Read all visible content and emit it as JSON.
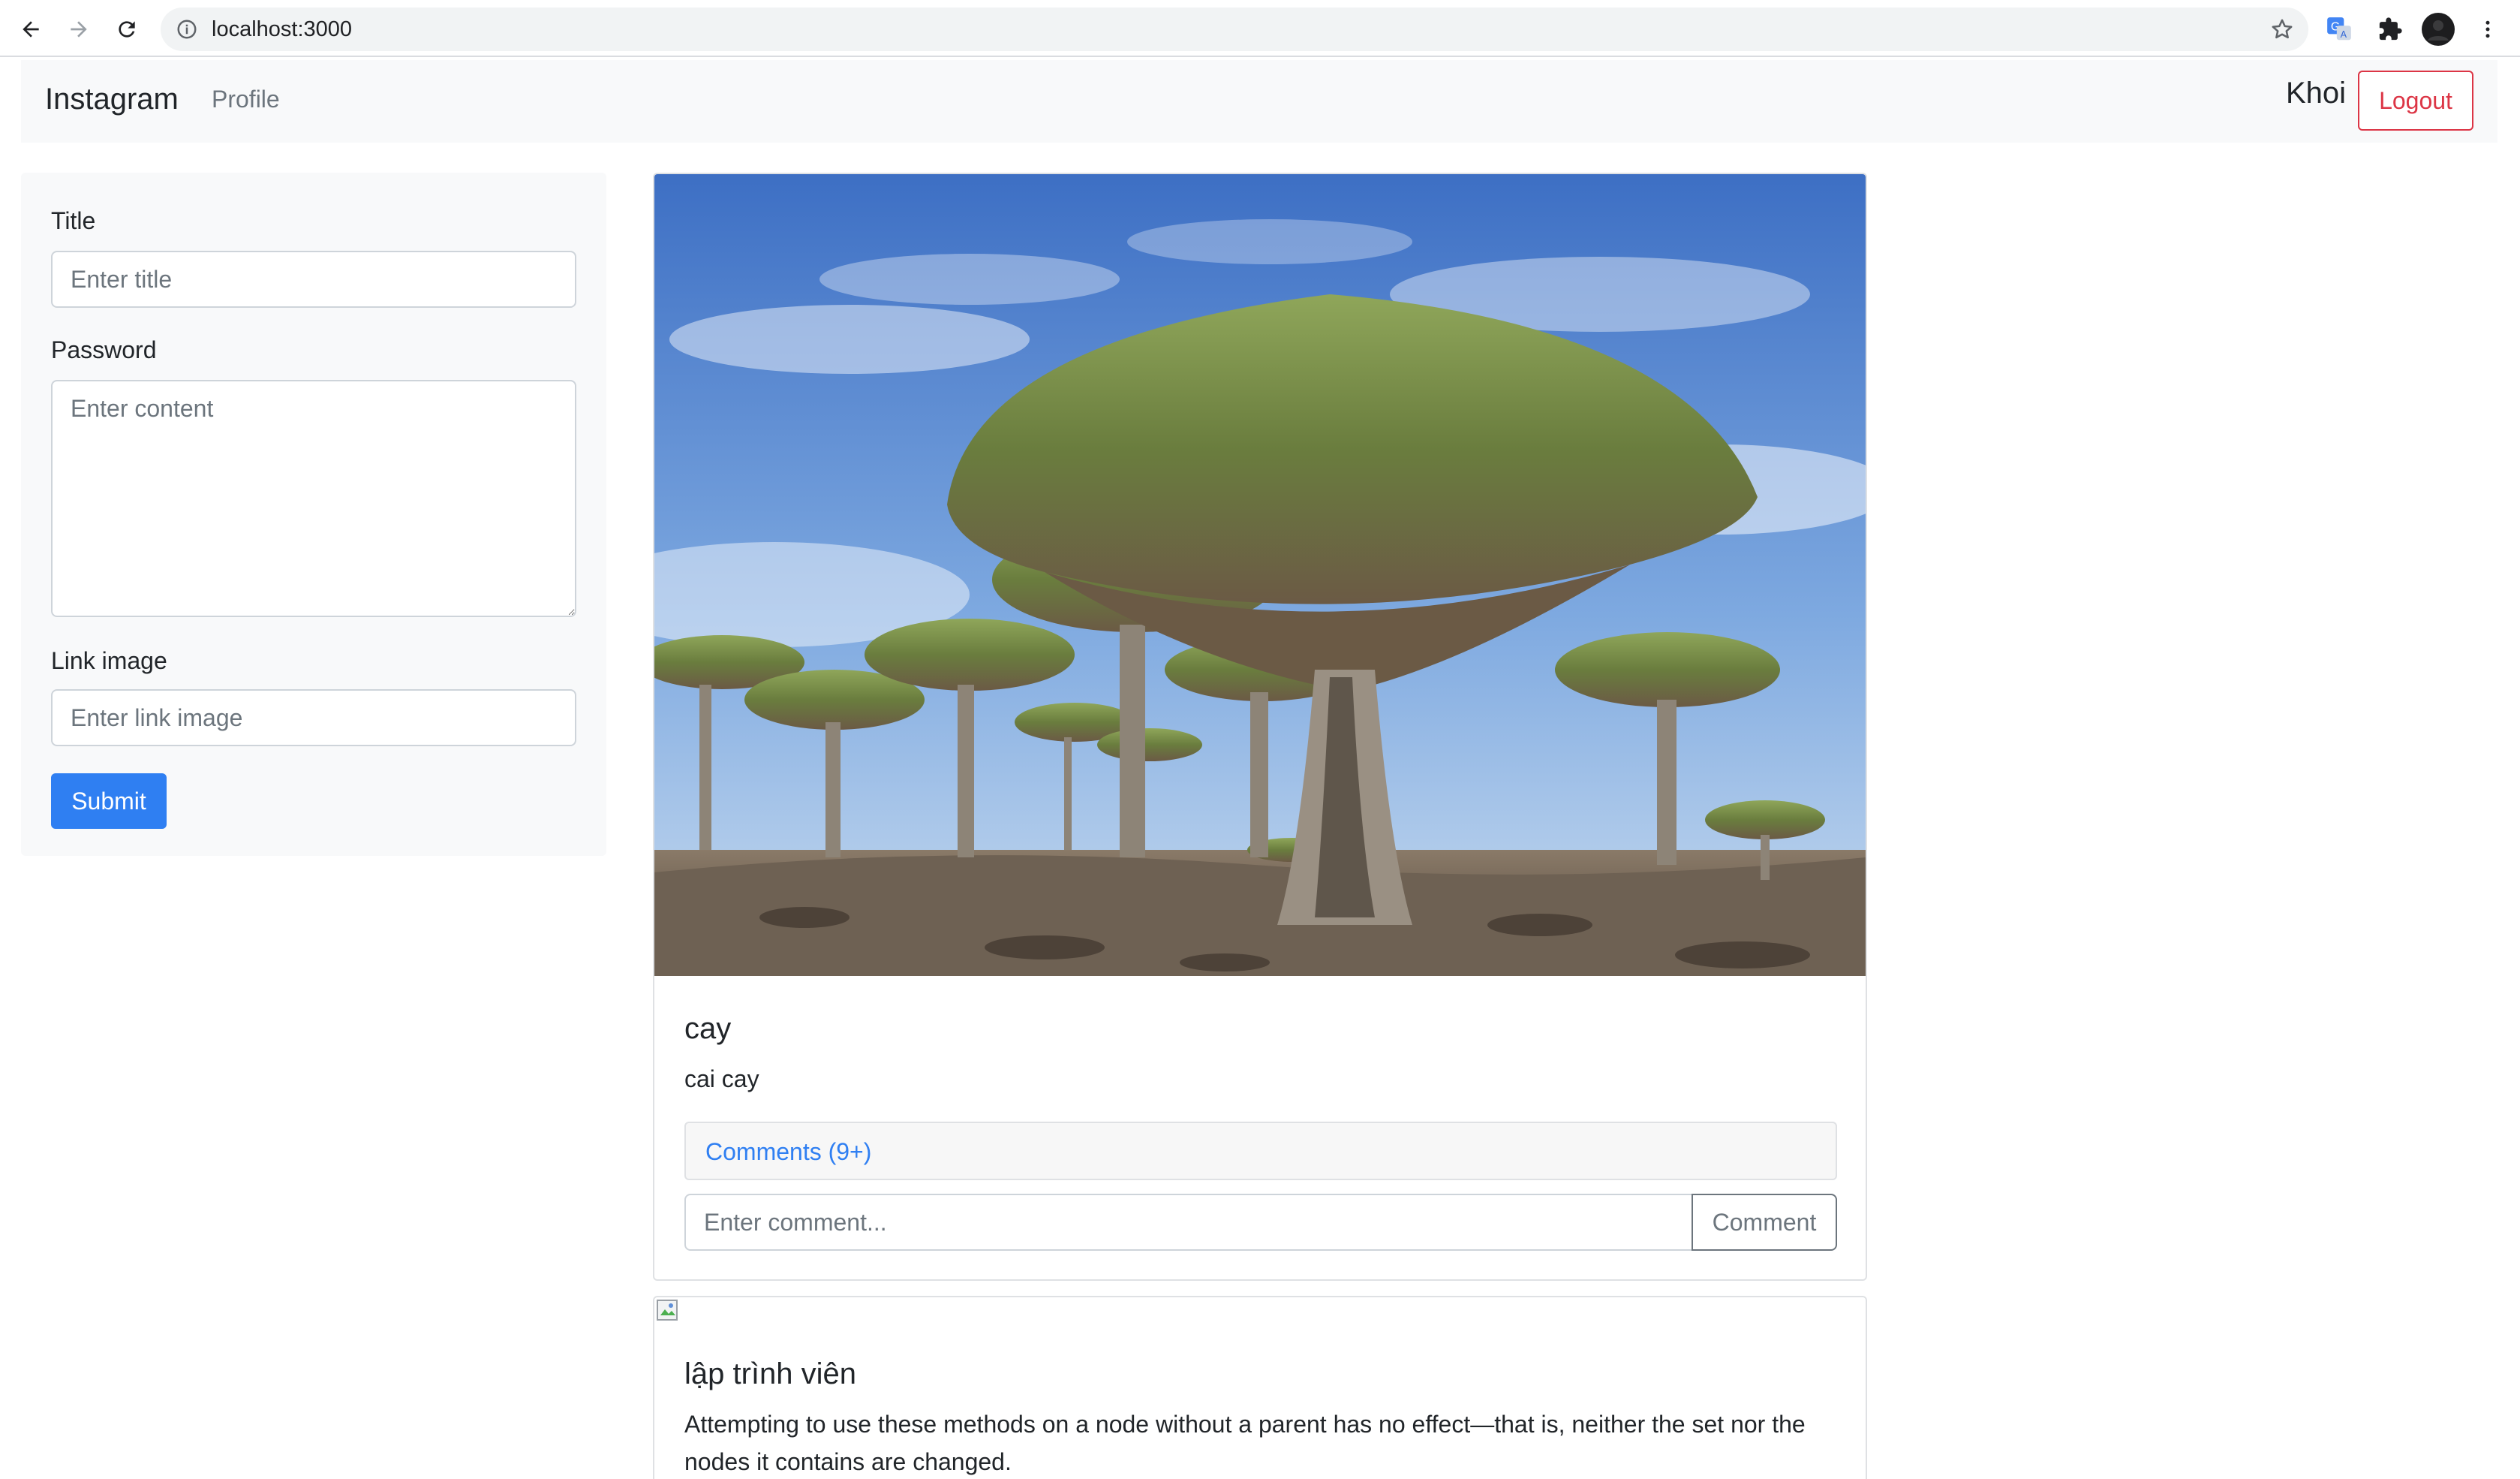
{
  "browser": {
    "url": "localhost:3000",
    "icons": [
      "back-arrow-icon",
      "forward-arrow-icon",
      "reload-icon",
      "info-icon",
      "star-icon",
      "translate-icon",
      "puzzle-icon",
      "profile-avatar-icon",
      "more-vert-icon"
    ]
  },
  "navbar": {
    "brand": "Instagram",
    "profile_link": "Profile",
    "username": "Khoi",
    "logout_label": "Logout"
  },
  "form": {
    "title_label": "Title",
    "title_placeholder": "Enter title",
    "content_label": "Password",
    "content_placeholder": "Enter content",
    "image_label": "Link image",
    "image_placeholder": "Enter link image",
    "submit_label": "Submit"
  },
  "posts": [
    {
      "title": "cay",
      "content": "cai cay",
      "comments_label": "Comments (9+)",
      "comment_placeholder": "Enter comment...",
      "comment_button": "Comment"
    },
    {
      "title": "lập trình viên",
      "content": "Attempting to use these methods on a node without a parent has no effect—that is, neither the set nor the nodes it contains are changed."
    }
  ],
  "colors": {
    "primary": "#2f7ff2",
    "danger": "#dc3545",
    "secondary": "#6c757d",
    "panel": "#f8f9fa"
  }
}
